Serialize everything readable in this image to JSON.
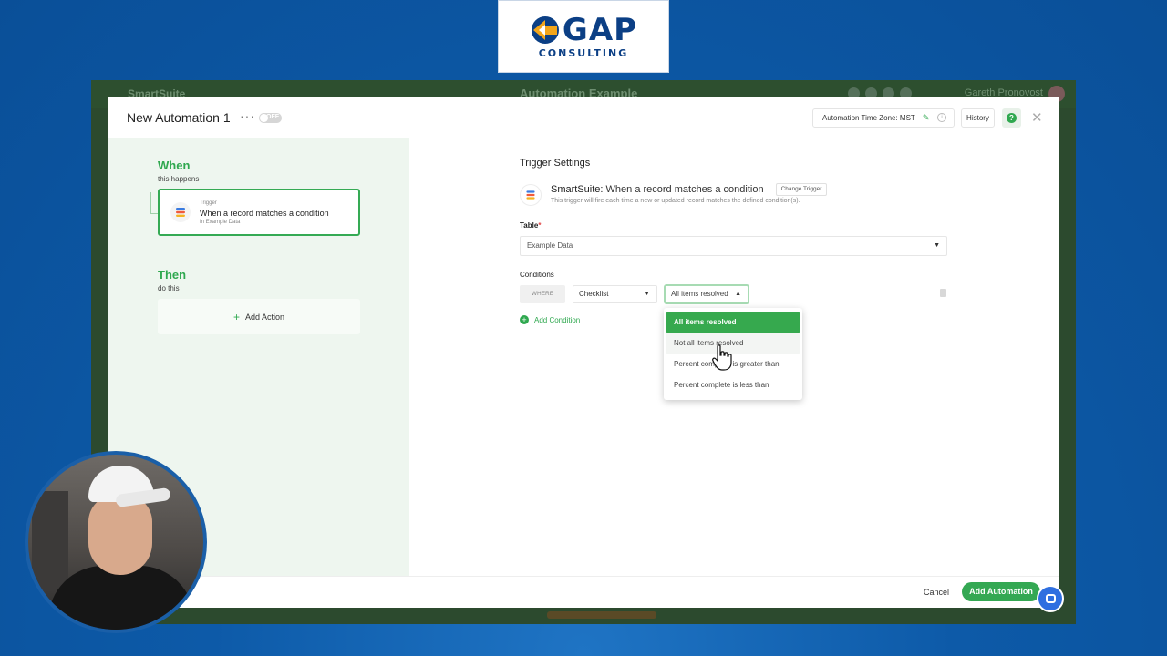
{
  "logo": {
    "main": "GAP",
    "sub": "CONSULTING"
  },
  "app": {
    "brand": "SmartSuite",
    "workspace": "Automation Example",
    "user": "Gareth Pronovost"
  },
  "modal": {
    "title": "New Automation 1",
    "more": "···",
    "toggle_label": "OFF",
    "timezone_label": "Automation Time Zone: MST",
    "history_label": "History",
    "help": "?",
    "close": "✕"
  },
  "flow": {
    "when_title": "When",
    "when_sub": "this happens",
    "trigger_small": "Trigger",
    "trigger_main": "When a record matches a condition",
    "trigger_sub": "In Example Data",
    "then_title": "Then",
    "then_sub": "do this",
    "add_action": "Add Action"
  },
  "settings": {
    "title": "Trigger Settings",
    "trigger_app": "SmartSuite:",
    "trigger_name": "When a record matches a condition",
    "change_trigger": "Change Trigger",
    "trigger_desc": "This trigger will fire each time a new or updated record matches the defined condition(s).",
    "table_label": "Table",
    "table_value": "Example Data",
    "conditions_label": "Conditions",
    "where": "WHERE",
    "field_value": "Checklist",
    "operator_value": "All items resolved",
    "add_condition": "Add Condition"
  },
  "dropdown": {
    "options": [
      "All items resolved",
      "Not all items resolved",
      "Percent complete is greater than",
      "Percent complete is less than"
    ]
  },
  "footer": {
    "cancel": "Cancel",
    "add_automation": "Add Automation"
  },
  "colors": {
    "accent_green": "#34a853",
    "brand_blue": "#0b3f85",
    "background_blue": "#0d5aa8"
  }
}
